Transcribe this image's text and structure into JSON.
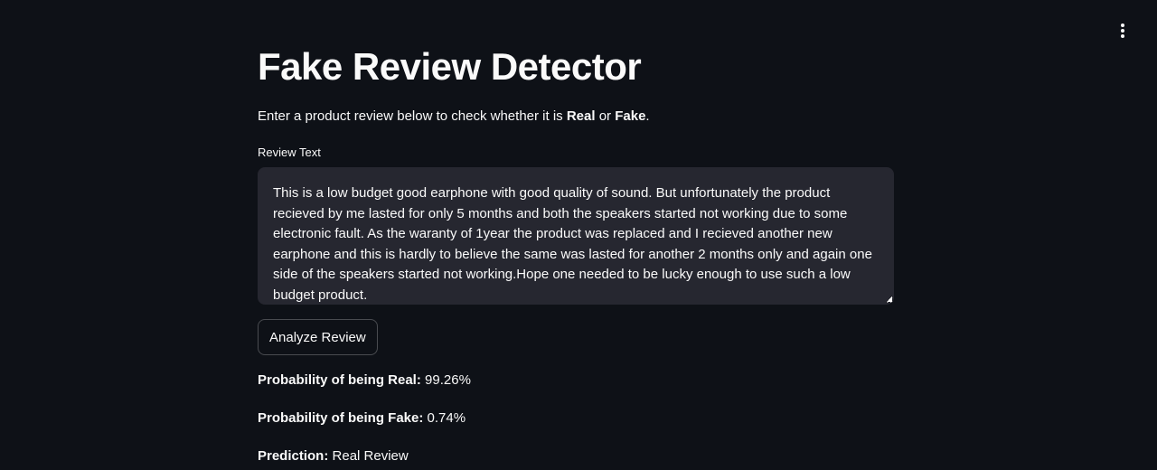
{
  "app": {
    "title": "Fake Review Detector",
    "intro": {
      "prefix": "Enter a product review below to check whether it is ",
      "real": "Real",
      "middle": " or ",
      "fake": "Fake",
      "suffix": "."
    },
    "menu_icon": "kebab-menu-icon"
  },
  "form": {
    "label": "Review Text",
    "review_value": "This is a low budget good earphone with good quality of sound. But unfortunately the product recieved by me lasted for only 5 months and both the speakers started not working due to some electronic fault. As the waranty of 1year the product was replaced and I recieved another new earphone and this is hardly to believe the same was lasted for another 2 months only and again one side of the speakers started not working.Hope one needed to be lucky enough to use such a low budget product.",
    "button_label": "Analyze Review"
  },
  "results": {
    "real_label": "Probability of being Real:",
    "real_value": "99.26%",
    "fake_label": "Probability of being Fake:",
    "fake_value": "0.74%",
    "prediction_label": "Prediction:",
    "prediction_value": "Real Review"
  },
  "colors": {
    "background": "#0e1117",
    "input_background": "#262730",
    "text": "#fafafa"
  }
}
